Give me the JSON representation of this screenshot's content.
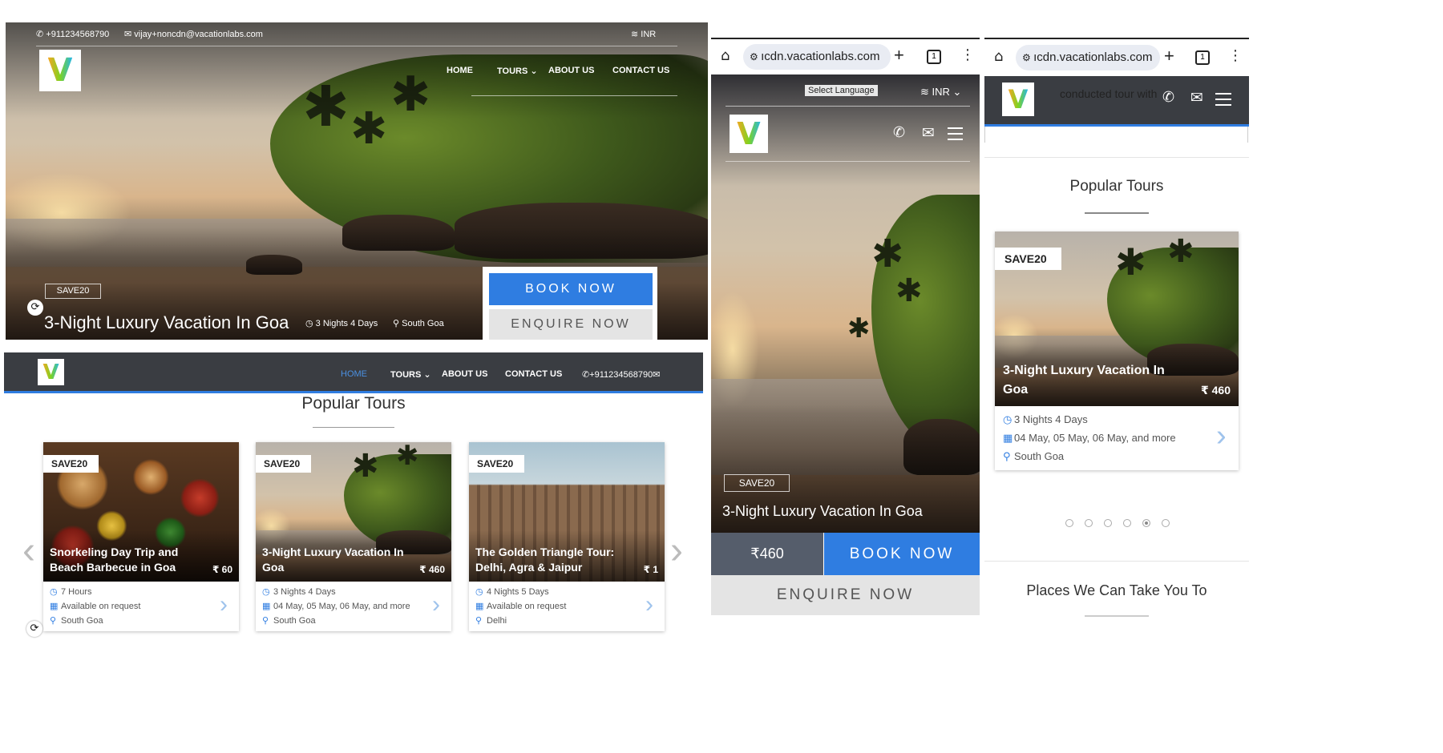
{
  "desktop_hero": {
    "phone": "+911234568790",
    "email": "vijay+noncdn@vacationlabs.com",
    "currency": "INR",
    "nav": [
      "HOME",
      "TOURS",
      "ABOUT US",
      "CONTACT US"
    ],
    "badge": "SAVE20",
    "title": "3-Night Luxury Vacation In Goa",
    "duration": "3 Nights 4 Days",
    "location": "South Goa",
    "book_now": "BOOK NOW",
    "enquire_now": "ENQUIRE NOW"
  },
  "desktop_sticky": {
    "nav": [
      "HOME",
      "TOURS",
      "ABOUT US",
      "CONTACT US"
    ],
    "phone": "+911234568790",
    "active": "HOME"
  },
  "popular": {
    "heading": "Popular Tours",
    "cards": [
      {
        "badge": "SAVE20",
        "title_l1": "Snorkeling Day Trip and",
        "title_l2": "Beach Barbecue in Goa",
        "price": "₹ 60",
        "l1": "7 Hours",
        "l2": "Available on request",
        "l3": "South Goa"
      },
      {
        "badge": "SAVE20",
        "title_l1": "3-Night Luxury Vacation In",
        "title_l2": "Goa",
        "price": "₹ 460",
        "l1": "3 Nights 4 Days",
        "l2": "04 May, 05 May, 06 May, and more",
        "l3": "South Goa"
      },
      {
        "badge": "SAVE20",
        "title_l1": "The Golden Triangle Tour:",
        "title_l2": "Delhi, Agra & Jaipur",
        "price": "₹ 1",
        "l1": "4 Nights 5 Days",
        "l2": "Available on request",
        "l3": "Delhi"
      }
    ],
    "prev_arrow": "‹",
    "next_arrow": "›"
  },
  "mobile1": {
    "url": "ıcdn.vacationlabs.com",
    "select_language": "Select Language",
    "currency": "INR",
    "badge": "SAVE20",
    "title": "3-Night Luxury Vacation In Goa",
    "price": "₹460",
    "book_now": "BOOK NOW",
    "enquire_now": "ENQUIRE NOW"
  },
  "mobile2": {
    "url": "ıcdn.vacationlabs.com",
    "overlay_text": "conducted tour with",
    "heading": "Popular Tours",
    "card": {
      "badge": "SAVE20",
      "title_l1": "3-Night Luxury Vacation In",
      "title_l2": "Goa",
      "price": "₹ 460",
      "l1": "3 Nights 4 Days",
      "l2": "04 May, 05 May, 06 May, and more",
      "l3": "South Goa"
    },
    "places_heading": "Places We Can Take You To",
    "dots": 6,
    "active_dot": 5
  },
  "colors": {
    "accent": "#2f7de1",
    "dark": "#3a3d42"
  }
}
